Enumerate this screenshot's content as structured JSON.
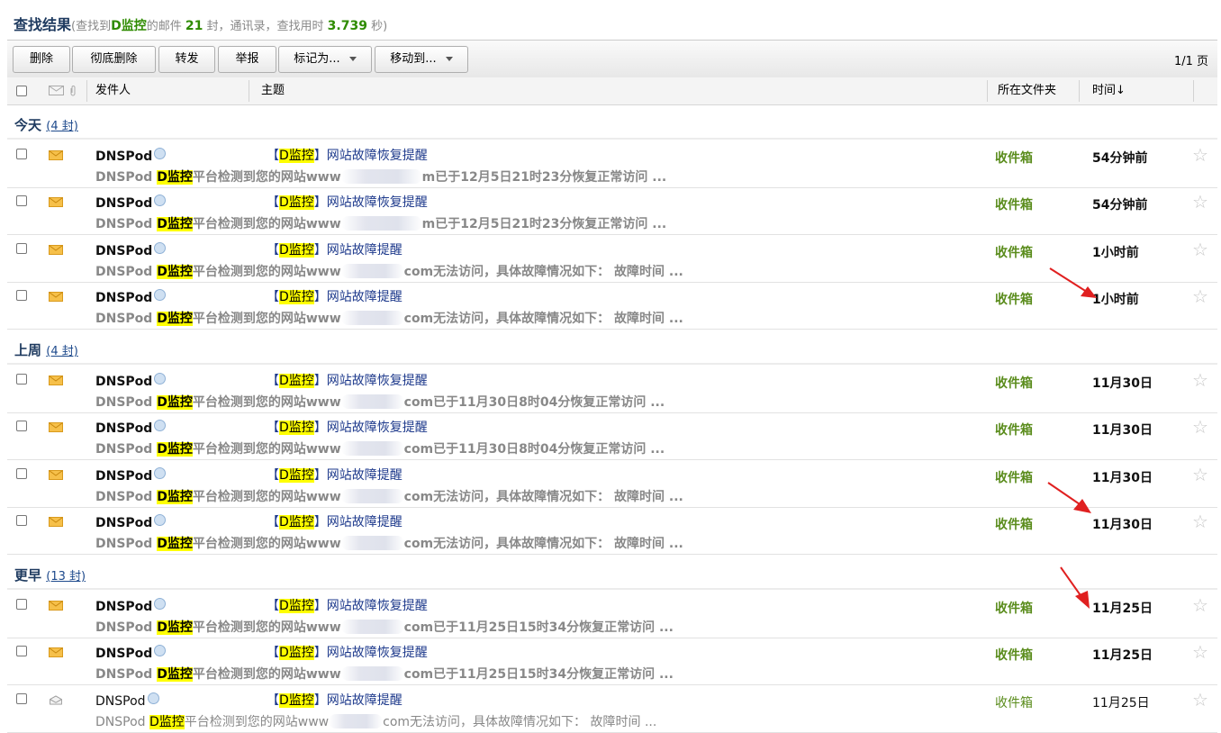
{
  "header": {
    "title": "查找结果",
    "info_prefix": "(查找到",
    "keyword": "D监控",
    "info_mid": "的邮件",
    "count": "21",
    "info_mid2": "封，通讯录，查找用时",
    "elapsed": "3.739",
    "info_suffix": "秒)"
  },
  "toolbar": {
    "delete": "删除",
    "delete_permanent": "彻底删除",
    "forward": "转发",
    "report": "举报",
    "mark_as": "标记为...",
    "move_to": "移动到...",
    "pager": "1/1 页"
  },
  "columns": {
    "sender": "发件人",
    "subject": "主题",
    "folder": "所在文件夹",
    "time": "时间↓"
  },
  "groups": [
    {
      "title": "今天",
      "count": "(4 封)"
    },
    {
      "title": "上周",
      "count": "(4 封)"
    },
    {
      "title": "更早",
      "count": "(13 封)"
    }
  ],
  "common": {
    "sender": "DNSPod",
    "tag": "D监控",
    "bracket_open": "【",
    "bracket_close": "】",
    "folder": "收件箱",
    "preview_prefix": "DNSPod ",
    "preview_platform": "平台检测到您的网站www"
  },
  "emails": [
    {
      "subject": "网站故障恢复提醒",
      "preview_rest": "m已于12月5日21时23分恢复正常访问 ...",
      "time": "54分钟前",
      "read": false
    },
    {
      "subject": "网站故障恢复提醒",
      "preview_rest": "m已于12月5日21时23分恢复正常访问 ...",
      "time": "54分钟前",
      "read": false
    },
    {
      "subject": "网站故障提醒",
      "preview_rest": "com无法访问，具体故障情况如下： 故障时间 ...",
      "time": "1小时前",
      "read": false
    },
    {
      "subject": "网站故障提醒",
      "preview_rest": "com无法访问，具体故障情况如下： 故障时间 ...",
      "time": "1小时前",
      "read": false
    },
    {
      "subject": "网站故障恢复提醒",
      "preview_rest": "com已于11月30日8时04分恢复正常访问 ...",
      "time": "11月30日",
      "read": false
    },
    {
      "subject": "网站故障恢复提醒",
      "preview_rest": "com已于11月30日8时04分恢复正常访问 ...",
      "time": "11月30日",
      "read": false
    },
    {
      "subject": "网站故障提醒",
      "preview_rest": "com无法访问，具体故障情况如下： 故障时间 ...",
      "time": "11月30日",
      "read": false
    },
    {
      "subject": "网站故障提醒",
      "preview_rest": "com无法访问，具体故障情况如下： 故障时间 ...",
      "time": "11月30日",
      "read": false
    },
    {
      "subject": "网站故障恢复提醒",
      "preview_rest": "com已于11月25日15时34分恢复正常访问 ...",
      "time": "11月25日",
      "read": false
    },
    {
      "subject": "网站故障恢复提醒",
      "preview_rest": "com已于11月25日15时34分恢复正常访问 ...",
      "time": "11月25日",
      "read": false
    },
    {
      "subject": "网站故障提醒",
      "preview_rest": "com无法访问，具体故障情况如下： 故障时间 ...",
      "time": "11月25日",
      "read": true
    }
  ],
  "icons": {
    "unread": "envelope-closed-icon",
    "read": "envelope-open-icon",
    "star": "star-outline-icon",
    "annotation": "red-arrow-icon"
  },
  "colors": {
    "unread_envelope": "#f0b030",
    "folder_green": "#5a8c1c",
    "highlight": "#ffff00",
    "arrow_red": "#e02020"
  }
}
